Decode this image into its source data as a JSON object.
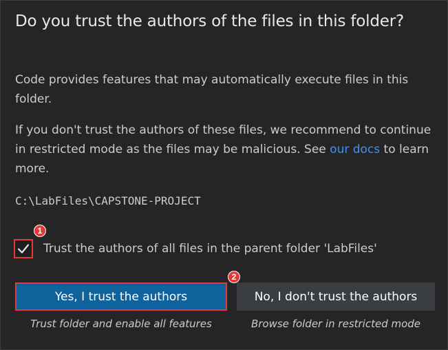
{
  "dialog": {
    "title": "Do you trust the authors of the files in this folder?",
    "paragraph1": "Code provides features that may automatically execute files in this folder.",
    "paragraph2_before": "If you don't trust the authors of these files, we recommend to continue in restricted mode as the files may be malicious. See ",
    "paragraph2_link": "our docs",
    "paragraph2_after": " to learn more.",
    "folder_path": "C:\\LabFiles\\CAPSTONE-PROJECT",
    "checkbox": {
      "label": "Trust the authors of all files in the parent folder 'LabFiles'",
      "checked": true
    },
    "buttons": {
      "yes_label": "Yes, I trust the authors",
      "yes_caption": "Trust folder and enable all features",
      "no_label": "No, I don't trust the authors",
      "no_caption": "Browse folder in restricted mode"
    }
  },
  "annotations": {
    "badge1": "1",
    "badge2": "2"
  },
  "colors": {
    "background": "#252526",
    "primary_button": "#0e639c",
    "secondary_button": "#3a3d41",
    "link": "#3794ff",
    "highlight": "#e53935"
  },
  "icons": {
    "checkbox_check": "checkmark-icon"
  }
}
